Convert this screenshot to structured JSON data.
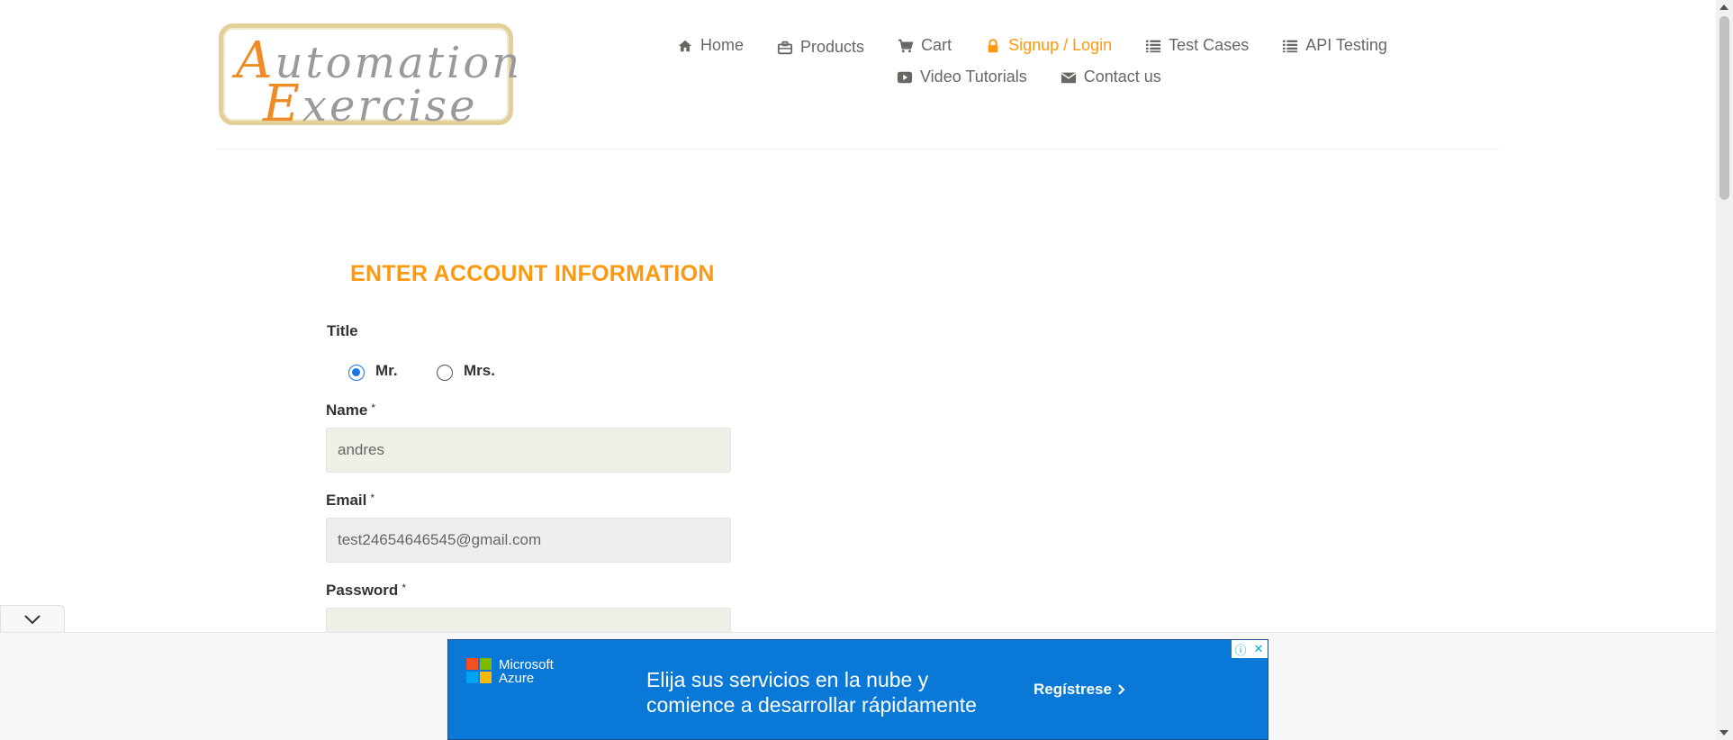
{
  "logo": {
    "first_letter": "A",
    "first_rest": "utomation",
    "second_letter": "E",
    "second_rest": "xercise"
  },
  "nav": {
    "row1": [
      {
        "label": "Home",
        "icon": "home-icon"
      },
      {
        "label": "Products",
        "icon": "briefcase-icon"
      },
      {
        "label": "Cart",
        "icon": "cart-icon"
      },
      {
        "label": "Signup / Login",
        "icon": "lock-icon",
        "active": true
      },
      {
        "label": "Test Cases",
        "icon": "list-icon"
      },
      {
        "label": "API Testing",
        "icon": "list-icon"
      }
    ],
    "row2": [
      {
        "label": "Video Tutorials",
        "icon": "video-icon"
      },
      {
        "label": "Contact us",
        "icon": "envelope-icon"
      }
    ]
  },
  "form": {
    "heading": "ENTER ACCOUNT INFORMATION",
    "title_label": "Title",
    "title_options": [
      {
        "label": "Mr.",
        "checked": true
      },
      {
        "label": "Mrs.",
        "checked": false
      }
    ],
    "name_label": "Name",
    "name_value": "andres",
    "email_label": "Email",
    "email_value": "test24654646545@gmail.com",
    "password_label": "Password",
    "password_value": "",
    "required_mark": "*"
  },
  "ad": {
    "brand_line1": "Microsoft",
    "brand_line2": "Azure",
    "headline_line1": "Elija sus servicios en la nube y",
    "headline_line2": "comience a desarrollar rápidamente",
    "cta": "Regístrese",
    "info_glyph": "ⓘ",
    "close_glyph": "✕"
  },
  "colors": {
    "accent": "#fe980f",
    "text": "#696763",
    "ad_bg": "#0a78d7"
  }
}
